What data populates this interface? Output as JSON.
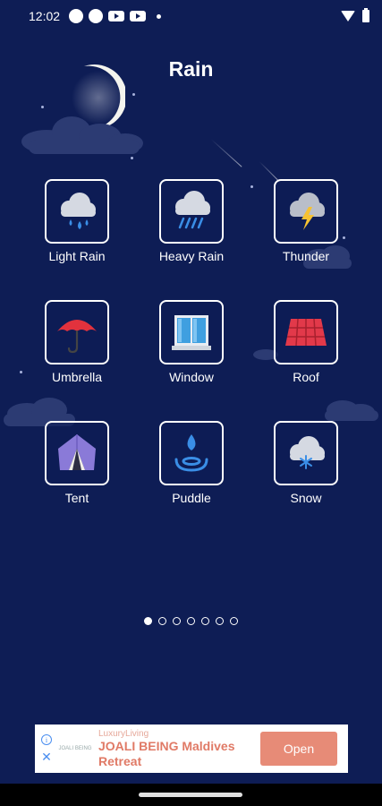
{
  "status_bar": {
    "time": "12:02"
  },
  "page": {
    "title": "Rain"
  },
  "tiles": [
    {
      "label": "Light Rain",
      "icon": "light-rain-icon"
    },
    {
      "label": "Heavy Rain",
      "icon": "heavy-rain-icon"
    },
    {
      "label": "Thunder",
      "icon": "thunder-icon"
    },
    {
      "label": "Umbrella",
      "icon": "umbrella-icon"
    },
    {
      "label": "Window",
      "icon": "window-icon"
    },
    {
      "label": "Roof",
      "icon": "roof-icon"
    },
    {
      "label": "Tent",
      "icon": "tent-icon"
    },
    {
      "label": "Puddle",
      "icon": "puddle-icon"
    },
    {
      "label": "Snow",
      "icon": "snow-icon"
    }
  ],
  "pager": {
    "total": 7,
    "active": 1
  },
  "ad": {
    "brand": "LuxuryLiving",
    "logo_text": "JOALI BEING",
    "title_line1": "JOALI BEING Maldives",
    "title_line2": "Retreat",
    "cta": "Open"
  },
  "colors": {
    "background": "#0e1d55",
    "accent": "#e78b77"
  }
}
